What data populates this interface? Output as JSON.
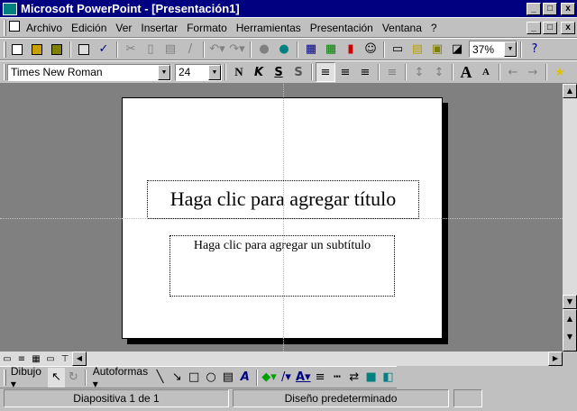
{
  "window": {
    "title": "Microsoft PowerPoint - [Presentación1]"
  },
  "menu": [
    "Archivo",
    "Edición",
    "Ver",
    "Insertar",
    "Formato",
    "Herramientas",
    "Presentación",
    "Ventana",
    "?"
  ],
  "format": {
    "font": "Times New Roman",
    "size": "24",
    "bold": "N",
    "italic": "K",
    "underline": "S",
    "shadow": "S"
  },
  "standard": {
    "zoom": "37%"
  },
  "slide": {
    "title_placeholder": "Haga clic para agregar título",
    "subtitle_placeholder": "Haga clic para agregar un subtítulo"
  },
  "drawing": {
    "draw_label": "Dibujo",
    "autoshapes_label": "Autoformas"
  },
  "status": {
    "slide": "Diapositiva 1 de 1",
    "design": "Diseño predeterminado"
  },
  "colors": {
    "titlebar": "#000080",
    "workspace": "#808080"
  }
}
